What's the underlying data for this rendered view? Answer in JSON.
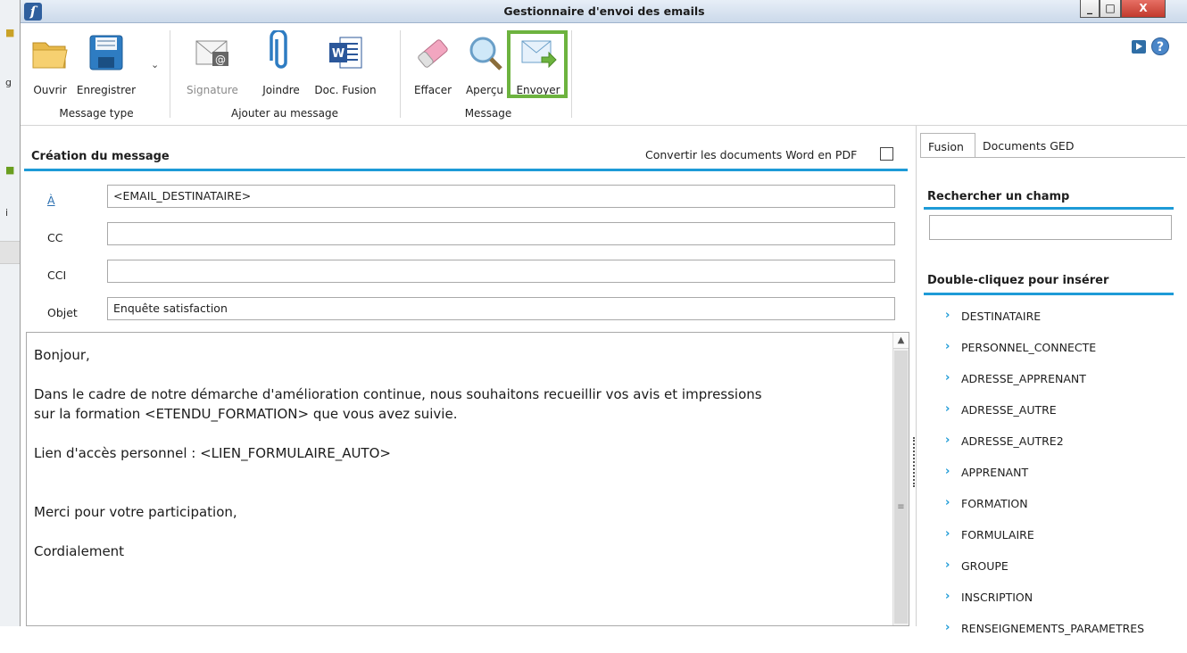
{
  "window": {
    "title": "Gestionnaire d'envoi des emails",
    "close_glyph": "X",
    "min_glyph": "_",
    "max_glyph": "□"
  },
  "ribbon": {
    "groups": [
      {
        "label": "Message type",
        "buttons": [
          {
            "label": "Ouvrir",
            "icon": "folder-icon"
          },
          {
            "label": "Enregistrer",
            "icon": "floppy-disk-icon"
          }
        ]
      },
      {
        "label": "Ajouter au message",
        "buttons": [
          {
            "label": "Signature",
            "icon": "signature-envelope-icon",
            "disabled": true
          },
          {
            "label": "Joindre",
            "icon": "paperclip-icon"
          },
          {
            "label": "Doc. Fusion",
            "icon": "word-document-icon"
          }
        ]
      },
      {
        "label": "Message",
        "buttons": [
          {
            "label": "Effacer",
            "icon": "eraser-icon"
          },
          {
            "label": "Aperçu",
            "icon": "magnifier-icon"
          },
          {
            "label": "Envoyer",
            "icon": "send-envelope-icon",
            "highlighted": true
          }
        ]
      }
    ],
    "highlight_color": "#6db33f"
  },
  "compose": {
    "title": "Création du message",
    "pdf_label": "Convertir les documents Word en PDF",
    "pdf_checked": false,
    "fields": {
      "to": {
        "label": "À",
        "value": "<EMAIL_DESTINATAIRE>"
      },
      "cc": {
        "label": "CC",
        "value": ""
      },
      "cci": {
        "label": "CCI",
        "value": ""
      },
      "subject": {
        "label": "Objet",
        "value": "Enquête satisfaction"
      }
    },
    "body": {
      "line1": "Bonjour,",
      "line2": "Dans le cadre de notre démarche d'amélioration continue, nous souhaitons recueillir vos avis et impressions",
      "line3": "sur la formation  <ETENDU_FORMATION> que vous avez suivie.",
      "line4": "Lien d'accès personnel : <LIEN_FORMULAIRE_AUTO>",
      "line5": "Merci pour votre participation,",
      "line6": "Cordialement"
    },
    "accent_color": "#1e9bd7"
  },
  "right_panel": {
    "tabs": [
      "Fusion",
      "Documents GED"
    ],
    "search_title": "Rechercher un champ",
    "insert_title": "Double-cliquez pour insérer",
    "fields": [
      "DESTINATAIRE",
      "PERSONNEL_CONNECTE",
      "ADRESSE_APPRENANT",
      "ADRESSE_AUTRE",
      "ADRESSE_AUTRE2",
      "APPRENANT",
      "FORMATION",
      "FORMULAIRE",
      "GROUPE",
      "INSCRIPTION",
      "RENSEIGNEMENTS_PARAMETRES"
    ]
  }
}
